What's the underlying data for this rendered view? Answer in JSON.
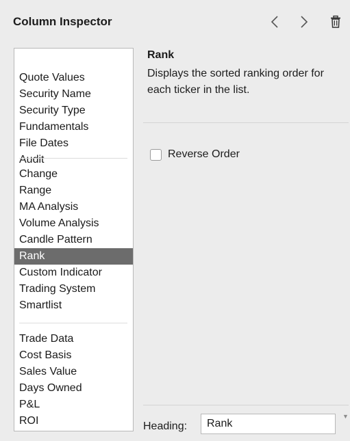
{
  "header": {
    "title": "Column Inspector",
    "back_icon": "chevron-left-icon",
    "forward_icon": "chevron-right-icon",
    "trash_icon": "trash-icon"
  },
  "sidebar": {
    "groups": [
      {
        "items": [
          "Quote Values",
          "Security Name",
          "Security Type",
          "Fundamentals",
          "File Dates",
          "Audit"
        ]
      },
      {
        "items": [
          "Change",
          "Range",
          "MA Analysis",
          "Volume Analysis",
          "Candle Pattern",
          "Rank",
          "Custom Indicator",
          "Trading System",
          "Smartlist"
        ]
      },
      {
        "items": [
          "Trade Data",
          "Cost Basis",
          "Sales Value",
          "Days Owned",
          "P&L",
          "ROI"
        ]
      }
    ],
    "selected": "Rank",
    "selection_color": "#6c6c6c"
  },
  "detail": {
    "title": "Rank",
    "description": "Displays the sorted ranking order for each ticker in the list.",
    "checkbox_label": "Reverse Order",
    "checkbox_checked": false,
    "heading_label": "Heading:",
    "heading_value": "Rank",
    "scroll_arrow": "▼"
  }
}
